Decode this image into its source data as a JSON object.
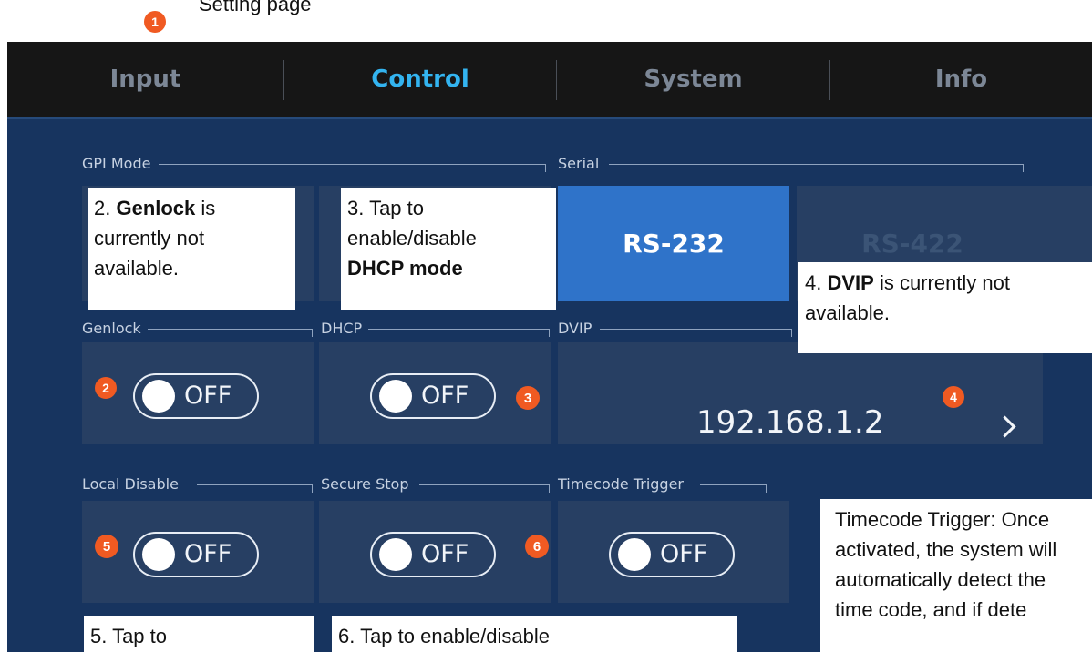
{
  "caption": "Setting page",
  "markers": {
    "m1": "1",
    "m2": "2",
    "m3": "3",
    "m4": "4",
    "m5": "5",
    "m6": "6"
  },
  "tabs": {
    "input": "Input",
    "control": "Control",
    "system": "System",
    "info": "Info"
  },
  "groups": {
    "gpi_mode": "GPI Mode",
    "serial": "Serial",
    "genlock": "Genlock",
    "dhcp": "DHCP",
    "dvip": "DVIP",
    "local_disable": "Local Disable",
    "secure_stop": "Secure Stop",
    "timecode_trigger": "Timecode Trigger"
  },
  "serial": {
    "rs232": "RS-232",
    "rs422": "RS-422",
    "selected": "RS-232"
  },
  "toggles": {
    "genlock": "OFF",
    "dhcp": "OFF",
    "local_disable": "OFF",
    "secure_stop": "OFF",
    "timecode_trigger": "OFF"
  },
  "dvip": {
    "ip": "192.168.1.2"
  },
  "notes": {
    "genlock": {
      "num": "2. ",
      "bold": "Genlock",
      "rest": " is currently not available."
    },
    "dhcp": {
      "line": "3. Tap to enable/disable",
      "bold": "DHCP mode"
    },
    "dvip": {
      "num": "4. ",
      "bold": "DVIP",
      "rest": " is currently not available."
    },
    "local_disable": {
      "text": "5. Tap to"
    },
    "secure_stop": {
      "text": "6. Tap to enable/disable"
    },
    "timecode": {
      "text": "Timecode Trigger: Once activated, the system will automatically detect the time code, and if dete"
    }
  },
  "colors": {
    "accent": "#33b4f0",
    "selected_tile": "#2f73c9",
    "panel": "#17345f",
    "marker": "#f05a22"
  }
}
